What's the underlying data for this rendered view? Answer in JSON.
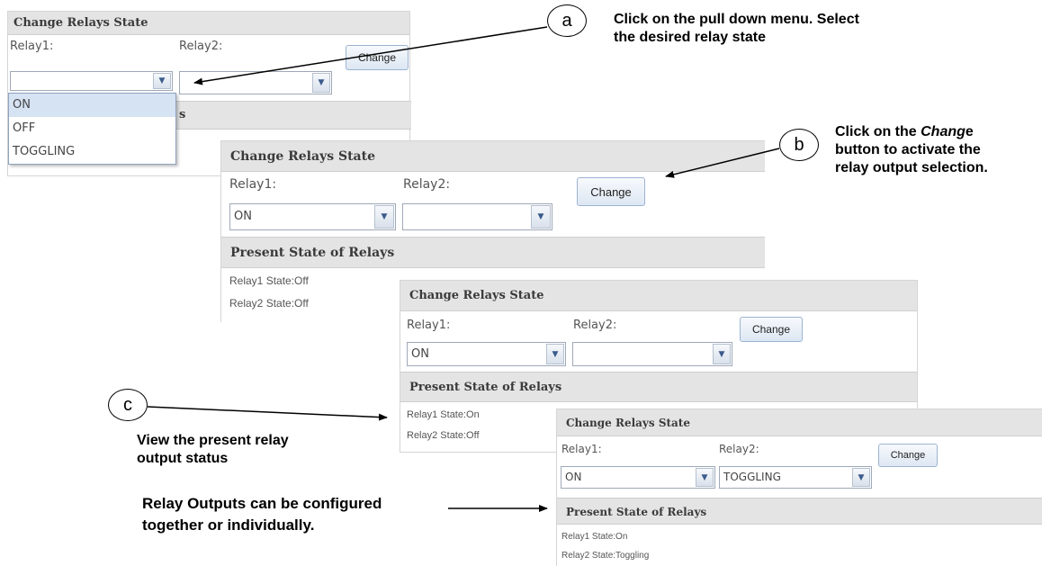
{
  "panel_a": {
    "header": "Change Relays State",
    "relay1_label": "Relay1:",
    "relay2_label": "Relay2:",
    "relay1_value": "",
    "relay2_value": "",
    "change_button": "Change",
    "present_header_partial": "s",
    "dropdown_options": [
      "ON",
      "OFF",
      "TOGGLING"
    ],
    "dropdown_selected_index": 0
  },
  "panel_b": {
    "header": "Change Relays State",
    "relay1_label": "Relay1:",
    "relay2_label": "Relay2:",
    "relay1_value": "ON",
    "relay2_value": "",
    "change_button": "Change",
    "present_header": "Present State of Relays",
    "relay1_state": "Relay1 State:Off",
    "relay2_state": "Relay2 State:Off"
  },
  "panel_c": {
    "header": "Change Relays State",
    "relay1_label": "Relay1:",
    "relay2_label": "Relay2:",
    "relay1_value": "ON",
    "relay2_value": "",
    "change_button": "Change",
    "present_header": "Present State of Relays",
    "relay1_state": "Relay1 State:On",
    "relay2_state": "Relay2 State:Off"
  },
  "panel_d": {
    "header": "Change Relays State",
    "relay1_label": "Relay1:",
    "relay2_label": "Relay2:",
    "relay1_value": "ON",
    "relay2_value": "TOGGLING",
    "change_button": "Change",
    "present_header": "Present State of Relays",
    "relay1_state": "Relay1 State:On",
    "relay2_state": "Relay2 State:Toggling"
  },
  "callouts": {
    "a_letter": "a",
    "a_line1": "Click on the pull down menu. Select",
    "a_line2": "the desired relay state",
    "b_letter": "b",
    "b_line1_pre": "Click on the ",
    "b_line1_em": "Chang",
    "b_line1_post": "e",
    "b_line2": "button to activate the",
    "b_line3": "relay output selection.",
    "c_letter": "c",
    "c_line1": "View the present relay",
    "c_line2": "output status",
    "note_line1": "Relay Outputs can be configured",
    "note_line2": "together or individually."
  },
  "icons": {
    "dropdown_arrow": "chevron-down-icon"
  }
}
